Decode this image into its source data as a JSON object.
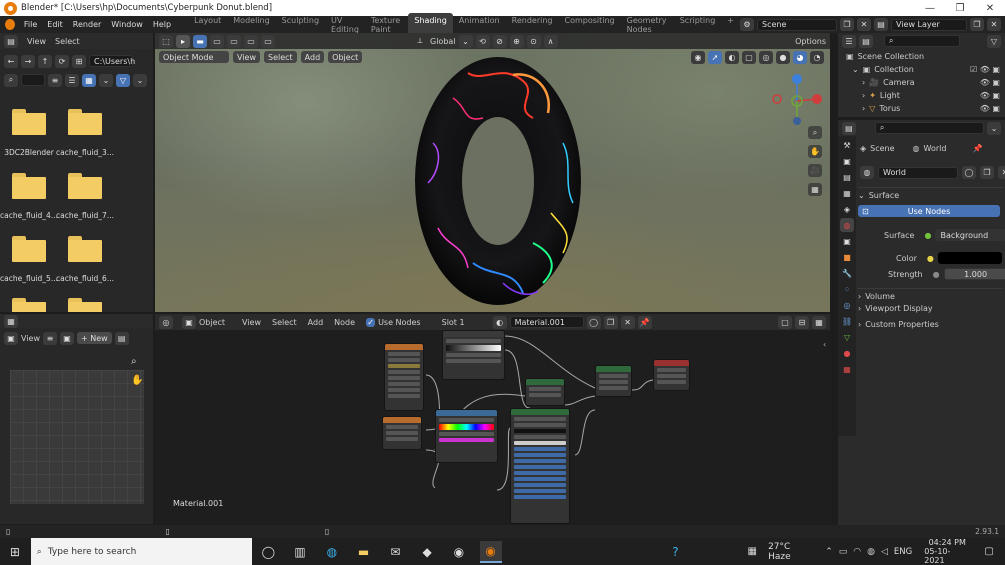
{
  "title_bar": {
    "text": "Blender* [C:\\Users\\hp\\Documents\\Cyberpunk Donut.blend]",
    "minimize": "—",
    "maximize": "❐",
    "close": "✕"
  },
  "menu": [
    "File",
    "Edit",
    "Render",
    "Window",
    "Help"
  ],
  "workspaces": [
    "Layout",
    "Modeling",
    "Sculpting",
    "UV Editing",
    "Texture Paint",
    "Shading",
    "Animation",
    "Rendering",
    "Compositing",
    "Geometry Nodes",
    "Scripting",
    "+"
  ],
  "active_workspace": "Shading",
  "scene_field": "Scene",
  "view_layer_field": "View Layer",
  "file_browser": {
    "view": "View",
    "select": "Select",
    "path": "C:\\Users\\h",
    "items": [
      "3DC2Blender",
      "cache_fluid_3...",
      "cache_fluid_4...",
      "cache_fluid_7...",
      "cache_fluid_5...",
      "cache_fluid_6...",
      "",
      ""
    ]
  },
  "image_editor": {
    "view": "View",
    "new_btn": "New"
  },
  "viewport": {
    "mode": "Object Mode",
    "menus": [
      "View",
      "Select",
      "Add",
      "Object"
    ],
    "orientation": "Global",
    "options": "Options"
  },
  "node_editor": {
    "editor_type": "Object",
    "menus": [
      "View",
      "Select",
      "Add",
      "Node"
    ],
    "use_nodes_label": "Use Nodes",
    "slot": "Slot 1",
    "material": "Material.001",
    "footer_label": "Material.001"
  },
  "outliner": {
    "scene_collection": "Scene Collection",
    "collection": "Collection",
    "objects": [
      "Camera",
      "Light",
      "Torus"
    ]
  },
  "properties": {
    "scene_tab": "Scene",
    "world_tab": "World",
    "world_name": "World",
    "surface_section": "Surface",
    "use_nodes_btn": "Use Nodes",
    "surface_label": "Surface",
    "surface_value": "Background",
    "color_label": "Color",
    "strength_label": "Strength",
    "strength_value": "1.000",
    "sections": [
      "Volume",
      "Viewport Display",
      "Custom Properties"
    ]
  },
  "version": "2.93.1",
  "taskbar": {
    "search_placeholder": "Type here to search",
    "weather": "27°C Haze",
    "lang": "ENG",
    "time": "04:24 PM",
    "date": "05-10-2021"
  },
  "colors": {
    "accent": "#4772b3",
    "blender_orange": "#e87d0d",
    "folder": "#f3cd63"
  }
}
